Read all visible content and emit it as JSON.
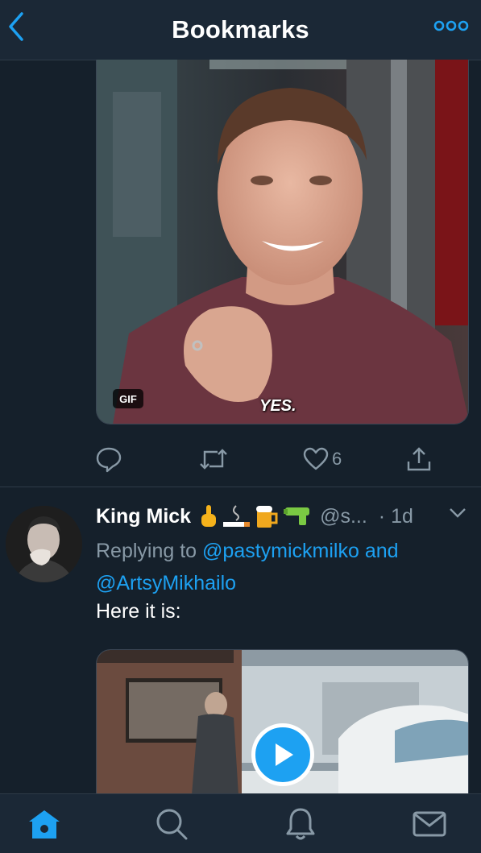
{
  "header": {
    "title": "Bookmarks",
    "back_icon": "chevron-left-icon",
    "more_icon": "more-dots-icon"
  },
  "tweet1": {
    "media_badge": "GIF",
    "caption": "YES.",
    "actions": {
      "reply_icon": "reply-icon",
      "retweet_icon": "retweet-icon",
      "like_icon": "heart-icon",
      "like_count": "6",
      "share_icon": "share-icon"
    }
  },
  "tweet2": {
    "author_name": "King Mick",
    "handle": "@s...",
    "time": "· 1d",
    "replying_prefix": "Replying to",
    "mention1": "@pastymickmilko",
    "and": "and",
    "mention2": "@ArtsyMikhailo",
    "text": "Here it is:"
  },
  "tabbar": {
    "items": [
      "home-icon",
      "search-icon",
      "notifications-icon",
      "messages-icon"
    ]
  },
  "colors": {
    "background": "#15202b",
    "bar": "#1b2836",
    "accent": "#1da1f2",
    "muted": "#8899a6"
  }
}
